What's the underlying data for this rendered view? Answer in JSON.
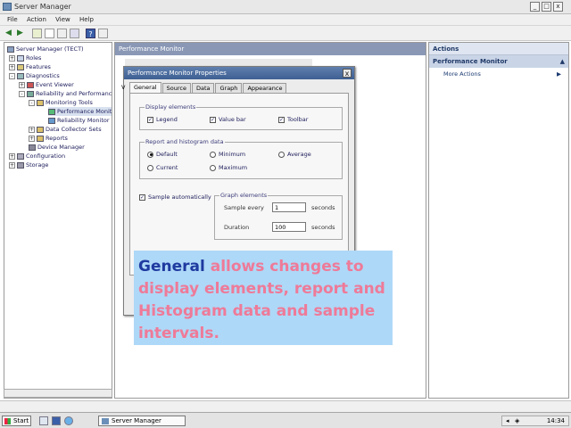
{
  "window": {
    "title": "Server Manager",
    "min": "_",
    "max": "□",
    "close": "x"
  },
  "menu": [
    "File",
    "Action",
    "View",
    "Help"
  ],
  "toolbar_icons": [
    "back-arrow-icon",
    "forward-arrow-icon",
    "up-folder-icon",
    "show-hide-tree-icon",
    "properties-icon",
    "export-icon",
    "help-icon",
    "console-icon"
  ],
  "tree": {
    "items": [
      {
        "label": "Server Manager (TECT)",
        "indent": 0,
        "expander": ""
      },
      {
        "label": "Roles",
        "indent": 1,
        "expander": "+"
      },
      {
        "label": "Features",
        "indent": 1,
        "expander": "+"
      },
      {
        "label": "Diagnostics",
        "indent": 1,
        "expander": "-"
      },
      {
        "label": "Event Viewer",
        "indent": 2,
        "expander": "+"
      },
      {
        "label": "Reliability and Performance",
        "indent": 2,
        "expander": "-"
      },
      {
        "label": "Monitoring Tools",
        "indent": 3,
        "expander": "-"
      },
      {
        "label": "Performance Monit",
        "indent": 4,
        "expander": ""
      },
      {
        "label": "Reliability Monitor",
        "indent": 4,
        "expander": ""
      },
      {
        "label": "Data Collector Sets",
        "indent": 3,
        "expander": "+"
      },
      {
        "label": "Reports",
        "indent": 3,
        "expander": "+"
      },
      {
        "label": "Device Manager",
        "indent": 2,
        "expander": ""
      },
      {
        "label": "Configuration",
        "indent": 1,
        "expander": "+"
      },
      {
        "label": "Storage",
        "indent": 1,
        "expander": "+"
      }
    ]
  },
  "center": {
    "title": "Performance Monitor"
  },
  "actions": {
    "header": "Actions",
    "section": "Performance Monitor",
    "more": "More Actions"
  },
  "dialog": {
    "title": "Performance Monitor Properties",
    "close": "x",
    "tabs": [
      "General",
      "Source",
      "Data",
      "Graph",
      "Appearance"
    ],
    "display_elements": {
      "title": "Display elements",
      "items": [
        {
          "label": "Legend",
          "checked": true
        },
        {
          "label": "Value bar",
          "checked": true
        },
        {
          "label": "Toolbar",
          "checked": true
        }
      ]
    },
    "report_data": {
      "title": "Report and histogram data",
      "options": [
        {
          "label": "Default",
          "selected": true
        },
        {
          "label": "Minimum",
          "selected": false
        },
        {
          "label": "Average",
          "selected": false
        },
        {
          "label": "Current",
          "selected": false
        },
        {
          "label": "Maximum",
          "selected": false
        }
      ]
    },
    "sample_auto": {
      "label": "Sample automatically",
      "checked": true
    },
    "graph_elements": {
      "title": "Graph elements",
      "sample_every_label": "Sample every",
      "sample_every_value": "1",
      "sample_every_unit": "seconds",
      "duration_label": "Duration",
      "duration_value": "100",
      "duration_unit": "seconds"
    },
    "partial_left_text": "V"
  },
  "callout": {
    "keyword": "General",
    "text": " allows changes to display elements, report and Histogram data and sample intervals.",
    "bg": "#aed8f7",
    "keyword_color": "#1f3aa0",
    "text_color": "#ee7a98"
  },
  "taskbar": {
    "start": "Start",
    "task": "Server Manager",
    "clock": "14:34"
  }
}
